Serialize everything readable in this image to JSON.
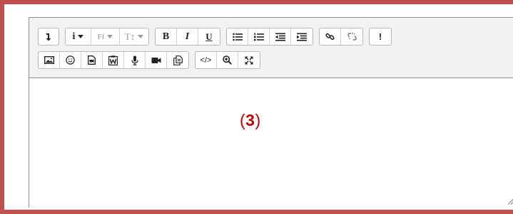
{
  "annotation": {
    "open": "(",
    "number": "3",
    "close": ")",
    "color": "#c00000"
  },
  "frame": {
    "border_color": "#c0504d"
  },
  "toolbar": {
    "row1": {
      "toggle_icon": "expand-toolbar-icon",
      "info_label": "i",
      "font_family_label": "Ff",
      "font_size_label": "T↕",
      "bold_label": "B",
      "italic_label": "I",
      "underline_label": "U",
      "list_icons": [
        "unordered-list-icon",
        "ordered-list-icon",
        "outdent-icon",
        "indent-icon"
      ],
      "link_icons": [
        "link-icon",
        "unlink-icon"
      ],
      "accessibility_label": "!"
    },
    "row2": {
      "media_icons": [
        "image-icon",
        "emoji-icon",
        "media-icon",
        "word-paste-icon",
        "record-audio-icon",
        "record-video-icon",
        "manage-files-icon"
      ],
      "html_label": "</>",
      "tool_icons": [
        "find-replace-icon",
        "fullscreen-icon"
      ]
    }
  },
  "content": {
    "text": ""
  }
}
